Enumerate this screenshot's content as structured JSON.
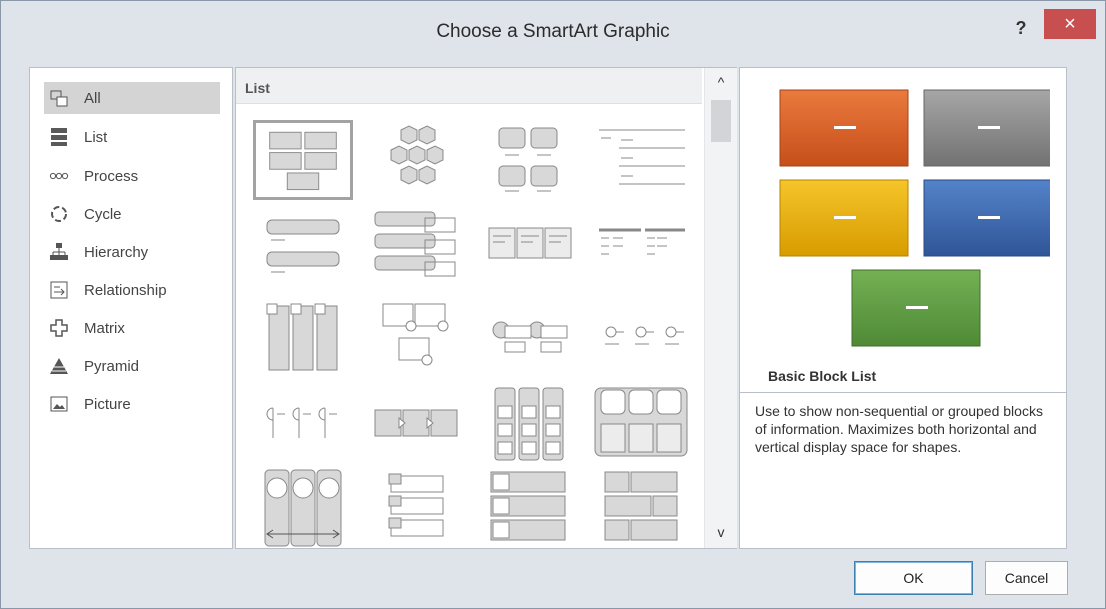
{
  "window": {
    "title": "Choose a SmartArt Graphic",
    "help_label": "?",
    "close_label": "×"
  },
  "categories": [
    {
      "label": "All",
      "icon": "all-icon"
    },
    {
      "label": "List",
      "icon": "list-icon"
    },
    {
      "label": "Process",
      "icon": "process-icon"
    },
    {
      "label": "Cycle",
      "icon": "cycle-icon"
    },
    {
      "label": "Hierarchy",
      "icon": "hierarchy-icon"
    },
    {
      "label": "Relationship",
      "icon": "relationship-icon"
    },
    {
      "label": "Matrix",
      "icon": "matrix-icon"
    },
    {
      "label": "Pyramid",
      "icon": "pyramid-icon"
    },
    {
      "label": "Picture",
      "icon": "picture-icon"
    }
  ],
  "selected_category": "All",
  "gallery": {
    "header": "List",
    "scroll_up": "^",
    "scroll_down": "v",
    "selected_layout": "Basic Block List"
  },
  "preview": {
    "title": "Basic Block List",
    "description": "Use to show non-sequential or grouped blocks of information. Maximizes both horizontal and vertical display space for shapes.",
    "colors": {
      "orange": "#d9622b",
      "gray": "#8a8a8a",
      "yellow": "#e9b00f",
      "blue": "#3b64ad",
      "green": "#5e9a45"
    }
  },
  "buttons": {
    "ok": "OK",
    "cancel": "Cancel"
  }
}
